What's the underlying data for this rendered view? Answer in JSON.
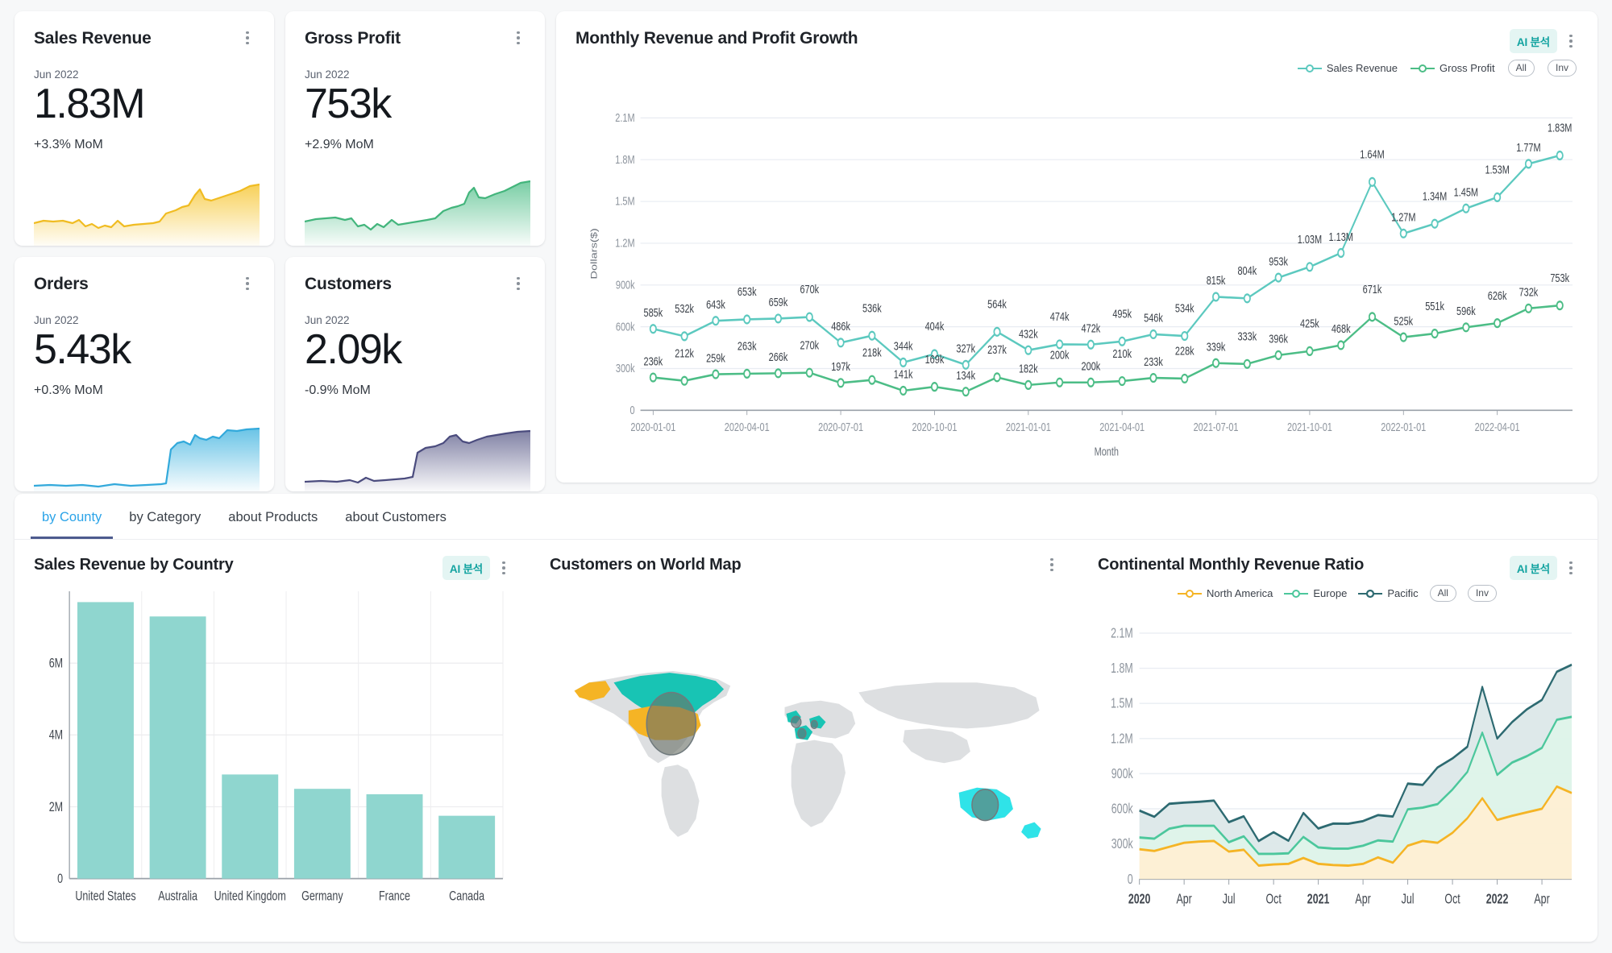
{
  "kpis": [
    {
      "title": "Sales Revenue",
      "date": "Jun 2022",
      "value": "1.83M",
      "delta": "+3.3% MoM",
      "color": "#f5c122",
      "name": "sales-revenue"
    },
    {
      "title": "Gross Profit",
      "date": "Jun 2022",
      "value": "753k",
      "delta": "+2.9% MoM",
      "color": "#4cbd86",
      "name": "gross-profit"
    },
    {
      "title": "Orders",
      "date": "Jun 2022",
      "value": "5.43k",
      "delta": "+0.3% MoM",
      "color": "#32a9db",
      "name": "orders"
    },
    {
      "title": "Customers",
      "date": "Jun 2022",
      "value": "2.09k",
      "delta": "-0.9% MoM",
      "color": "#4b4c7e",
      "name": "customers"
    }
  ],
  "main_chart": {
    "title": "Monthly Revenue and Profit Growth",
    "ai_button": "AI 분석",
    "legend": [
      {
        "label": "Sales Revenue",
        "color": "#5cc9bf"
      },
      {
        "label": "Gross Profit",
        "color": "#4cbd86"
      }
    ],
    "pills": [
      "All",
      "Inv"
    ]
  },
  "tabs": [
    {
      "label": "by County",
      "active": true
    },
    {
      "label": "by Category",
      "active": false
    },
    {
      "label": "about Products",
      "active": false
    },
    {
      "label": "about Customers",
      "active": false
    }
  ],
  "panel_country": {
    "title": "Sales Revenue by Country",
    "ai_button": "AI 분석"
  },
  "panel_map": {
    "title": "Customers on World Map"
  },
  "panel_continental": {
    "title": "Continental Monthly Revenue Ratio",
    "ai_button": "AI 분석",
    "legend": [
      {
        "label": "North America",
        "color": "#f5b425"
      },
      {
        "label": "Europe",
        "color": "#4cc79c"
      },
      {
        "label": "Pacific",
        "color": "#2d6a71"
      }
    ],
    "pills": [
      "All",
      "Inv"
    ]
  },
  "chart_data": [
    {
      "type": "line",
      "id": "monthly-revenue-profit-growth",
      "title": "Monthly Revenue and Profit Growth",
      "xlabel": "Month",
      "ylabel": "Dollars($)",
      "ylim": [
        0,
        2250000
      ],
      "yticks": [
        0,
        300000,
        600000,
        900000,
        1200000,
        1500000,
        1800000,
        2100000
      ],
      "ytick_labels": [
        "0",
        "300k",
        "600k",
        "900k",
        "1.2M",
        "1.5M",
        "1.8M",
        "2.1M"
      ],
      "xtick_labels": [
        "2020-01-01",
        "2020-04-01",
        "2020-07-01",
        "2020-10-01",
        "2021-01-01",
        "2021-04-01",
        "2021-07-01",
        "2021-10-01",
        "2022-01-01",
        "2022-04-01"
      ],
      "x": [
        "2020-01",
        "2020-02",
        "2020-03",
        "2020-04",
        "2020-05",
        "2020-06",
        "2020-07",
        "2020-08",
        "2020-09",
        "2020-10",
        "2020-11",
        "2020-12",
        "2021-01",
        "2021-02",
        "2021-03",
        "2021-04",
        "2021-05",
        "2021-06",
        "2021-07",
        "2021-08",
        "2021-09",
        "2021-10",
        "2021-11",
        "2021-12",
        "2022-01",
        "2022-02",
        "2022-03",
        "2022-04",
        "2022-05",
        "2022-06"
      ],
      "grid": true,
      "legend_position": "top-right",
      "series": [
        {
          "name": "Sales Revenue",
          "color": "#5cc9bf",
          "values": [
            585000,
            532000,
            643000,
            653000,
            659000,
            670000,
            486000,
            536000,
            344000,
            404000,
            327000,
            564000,
            432000,
            474000,
            472000,
            495000,
            546000,
            534000,
            815000,
            804000,
            953000,
            1030000,
            1130000,
            1640000,
            1270000,
            1340000,
            1450000,
            1530000,
            1770000,
            1830000
          ],
          "labels": [
            "585k",
            "532k",
            "643k",
            "653k",
            "659k",
            "670k",
            "486k",
            "536k",
            "344k",
            "404k",
            "327k",
            "564k",
            "432k",
            "474k",
            "472k",
            "495k",
            "546k",
            "534k",
            "815k",
            "804k",
            "953k",
            "1.03M",
            "1.13M",
            "1.64M",
            "1.27M",
            "1.34M",
            "1.45M",
            "1.53M",
            "1.77M",
            "1.83M"
          ]
        },
        {
          "name": "Gross Profit",
          "color": "#4cbd86",
          "values": [
            236000,
            212000,
            259000,
            263000,
            266000,
            270000,
            197000,
            218000,
            141000,
            169000,
            134000,
            237000,
            182000,
            200000,
            200000,
            210000,
            233000,
            228000,
            339000,
            333000,
            396000,
            425000,
            468000,
            671000,
            525000,
            551000,
            596000,
            626000,
            732000,
            753000
          ],
          "labels": [
            "236k",
            "212k",
            "259k",
            "263k",
            "266k",
            "270k",
            "197k",
            "218k",
            "141k",
            "169k",
            "134k",
            "237k",
            "182k",
            "200k",
            "200k",
            "210k",
            "233k",
            "228k",
            "339k",
            "333k",
            "396k",
            "425k",
            "468k",
            "671k",
            "525k",
            "551k",
            "596k",
            "626k",
            "732k",
            "753k"
          ]
        }
      ]
    },
    {
      "type": "bar",
      "id": "sales-revenue-by-country",
      "title": "Sales Revenue by Country",
      "categories": [
        "United States",
        "Australia",
        "United Kingdom",
        "Germany",
        "France",
        "Canada"
      ],
      "values": [
        7700000,
        7300000,
        2900000,
        2500000,
        2350000,
        1750000
      ],
      "xlabel": "",
      "ylabel": "",
      "ylim": [
        0,
        8000000
      ],
      "yticks": [
        0,
        2000000,
        4000000,
        6000000
      ],
      "ytick_labels": [
        "0",
        "2M",
        "4M",
        "6M"
      ],
      "color": "#8fd6cf",
      "grid": true
    },
    {
      "type": "area",
      "id": "continental-monthly-revenue-ratio",
      "title": "Continental Monthly Revenue Ratio",
      "ylim": [
        0,
        2250000
      ],
      "yticks": [
        0,
        300000,
        600000,
        900000,
        1200000,
        1500000,
        1800000,
        2100000
      ],
      "ytick_labels": [
        "0",
        "300k",
        "600k",
        "900k",
        "1.2M",
        "1.5M",
        "1.8M",
        "2.1M"
      ],
      "xtick_labels": [
        "2020",
        "Apr",
        "Jul",
        "Oct",
        "2021",
        "Apr",
        "Jul",
        "Oct",
        "2022",
        "Apr"
      ],
      "grid": true,
      "legend_position": "top-center",
      "stacked": true,
      "series": [
        {
          "name": "North America",
          "color": "#f5b425",
          "values": [
            255000,
            240000,
            275000,
            310000,
            320000,
            325000,
            235000,
            250000,
            115000,
            125000,
            130000,
            180000,
            130000,
            120000,
            115000,
            130000,
            185000,
            140000,
            285000,
            325000,
            310000,
            395000,
            520000,
            690000,
            505000,
            540000,
            570000,
            600000,
            790000,
            735000
          ]
        },
        {
          "name": "Europe",
          "color": "#4cc79c",
          "values": [
            100000,
            105000,
            155000,
            145000,
            135000,
            130000,
            80000,
            115000,
            100000,
            90000,
            90000,
            180000,
            140000,
            140000,
            145000,
            155000,
            145000,
            180000,
            310000,
            285000,
            330000,
            370000,
            395000,
            560000,
            385000,
            455000,
            480000,
            520000,
            570000,
            650000
          ]
        },
        {
          "name": "Pacific",
          "color": "#2d6a71",
          "values": [
            230000,
            187000,
            213000,
            198000,
            205000,
            215000,
            171000,
            171000,
            110000,
            185000,
            107000,
            204000,
            162000,
            214000,
            212000,
            210000,
            216000,
            214000,
            220000,
            194000,
            313000,
            265000,
            215000,
            390000,
            310000,
            345000,
            400000,
            410000,
            410000,
            445000
          ]
        }
      ]
    }
  ]
}
